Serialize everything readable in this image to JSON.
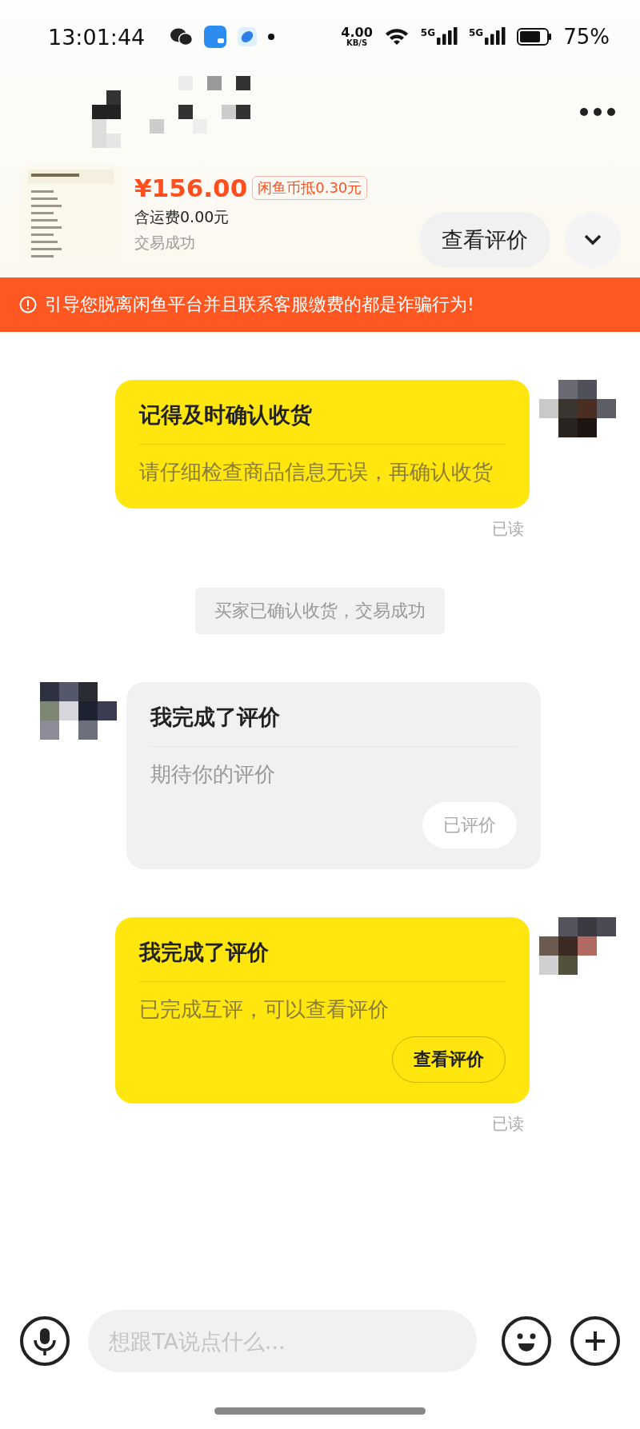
{
  "status_bar": {
    "time": "13:01:44",
    "speed": "4.00",
    "speed_unit": "KB/S",
    "network_1": "5G",
    "network_2": "5G",
    "battery": "75%"
  },
  "product": {
    "price": "¥156.00",
    "coin_badge": "闲鱼币抵0.30元",
    "shipping": "含运费0.00元",
    "status": "交易成功",
    "action": "查看评价"
  },
  "warning_banner": "引导您脱离闲鱼平台并且联系客服缴费的都是诈骗行为!",
  "messages": [
    {
      "kind": "card",
      "outgoing": true,
      "title": "记得及时确认收货",
      "body": "请仔细检查商品信息无误，再确认收货",
      "read": "已读"
    },
    {
      "kind": "notice",
      "text": "买家已确认收货，交易成功"
    },
    {
      "kind": "card",
      "outgoing": false,
      "title": "我完成了评价",
      "body": "期待你的评价",
      "button": {
        "label": "已评价",
        "disabled": true
      }
    },
    {
      "kind": "card",
      "outgoing": true,
      "title": "我完成了评价",
      "body": "已完成互评，可以查看评价",
      "button": {
        "label": "查看评价",
        "disabled": false
      },
      "read": "已读"
    }
  ],
  "composer": {
    "placeholder": "想跟TA说点什么..."
  }
}
